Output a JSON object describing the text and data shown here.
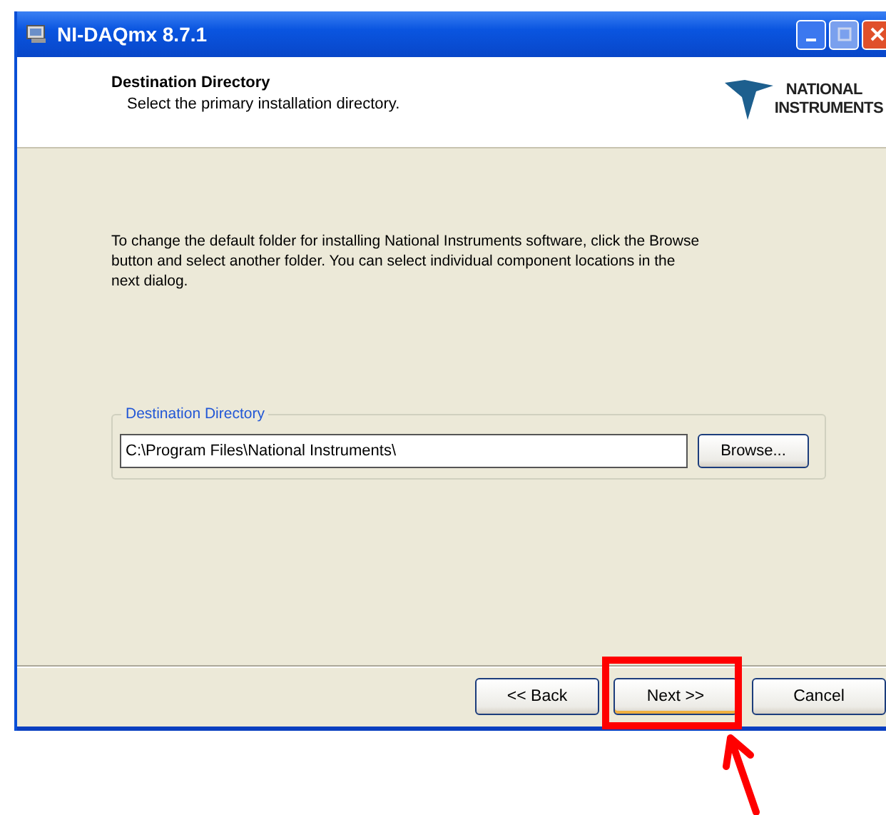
{
  "window": {
    "title": "NI-DAQmx 8.7.1"
  },
  "header": {
    "title": "Destination Directory",
    "subtitle": "Select the primary installation directory.",
    "logo": [
      "NATIONAL",
      "INSTRUMENTS"
    ]
  },
  "intro": "To change the default folder for installing National Instruments software, click the Browse button and select another folder. You can select individual component locations in the next dialog.",
  "destination": {
    "legend": "Destination Directory",
    "value": "C:\\Program Files\\National Instruments\\",
    "browse": "Browse..."
  },
  "buttons": [
    {
      "label": "<< Back",
      "highlighted": false
    },
    {
      "label": "Next >>",
      "highlighted": true
    },
    {
      "label": "Cancel",
      "highlighted": false
    }
  ]
}
